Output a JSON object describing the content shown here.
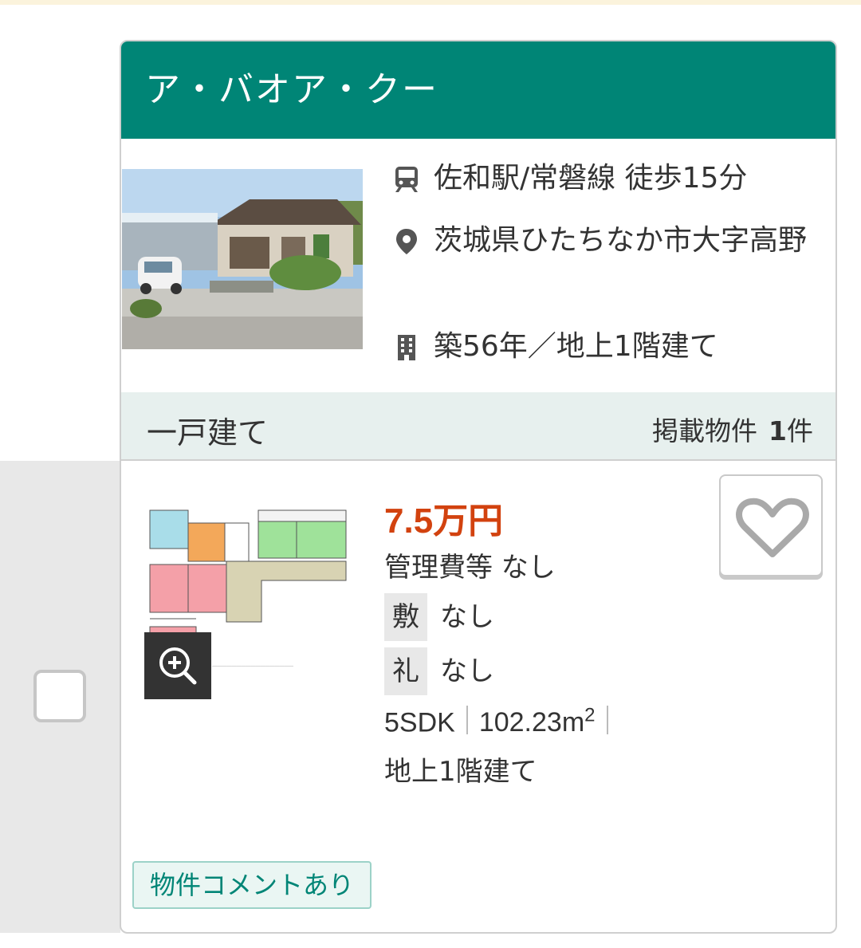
{
  "property": {
    "name": "ア・バオア・クー",
    "access": {
      "icon": "train-icon",
      "text": "佐和駅/常磐線 徒歩15分"
    },
    "address": {
      "icon": "map-pin-icon",
      "text": "茨城県ひたちなか市大字高野"
    },
    "building": {
      "icon": "building-icon",
      "text": "築56年／地上1階建て"
    },
    "type": "一戸建て",
    "listing_count_label": "掲載物件",
    "listing_count": "1",
    "listing_count_unit": "件"
  },
  "unit": {
    "rent": "7.5万円",
    "management_fee": "管理費等  なし",
    "deposit_label": "敷",
    "deposit_value": "なし",
    "key_money_label": "礼",
    "key_money_value": "なし",
    "layout": "5SDK",
    "area_value": "102.23m",
    "area_exp": "2",
    "floor": "地上1階建て",
    "comment_tag": "物件コメントあり"
  },
  "colors": {
    "brand_green": "#008576",
    "price_red": "#d2420f",
    "type_bar_bg": "#e7f0ee"
  },
  "icons": {
    "zoom": "zoom-in-icon",
    "favorite": "heart-icon",
    "checkbox": "checkbox-icon"
  }
}
